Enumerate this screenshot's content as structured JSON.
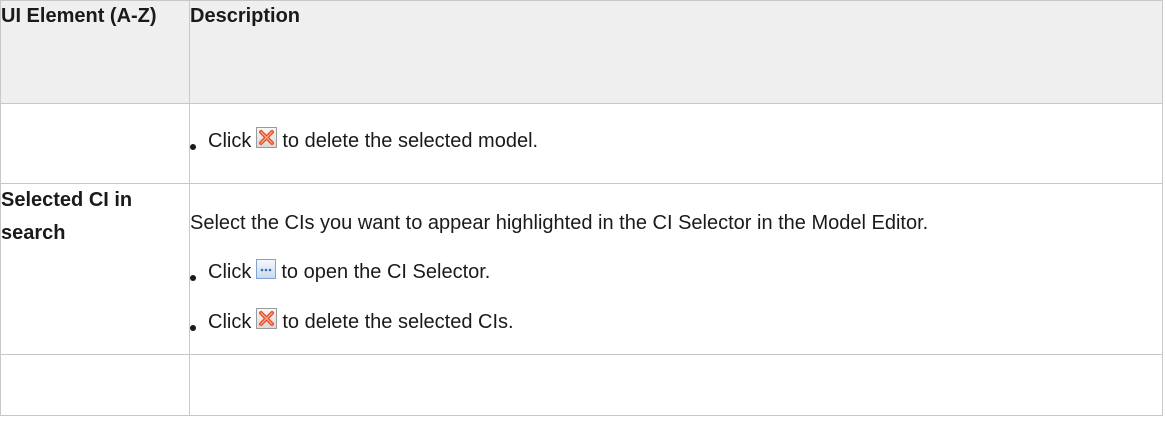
{
  "table": {
    "headers": {
      "element": "UI Element (A-Z)",
      "description": "Description"
    },
    "rows": [
      {
        "element": "",
        "description_paragraph": "",
        "bullets": [
          {
            "prefix": "Click",
            "icon": "delete-x-icon",
            "suffix": "to delete the selected model."
          }
        ]
      },
      {
        "element": "Selected CI in search",
        "description_paragraph": "Select the CIs you want to appear highlighted in the CI Selector in the Model Editor.",
        "bullets": [
          {
            "prefix": "Click",
            "icon": "ellipsis-browse-icon",
            "suffix": "to open the CI Selector."
          },
          {
            "prefix": "Click",
            "icon": "delete-x-icon",
            "suffix": "to delete the selected CIs."
          }
        ]
      }
    ]
  },
  "colors": {
    "header_bg": "#efefef",
    "border": "#c8c8c8",
    "delete_icon": "#e8502e",
    "ellipsis_icon": "#3a6fb0"
  }
}
